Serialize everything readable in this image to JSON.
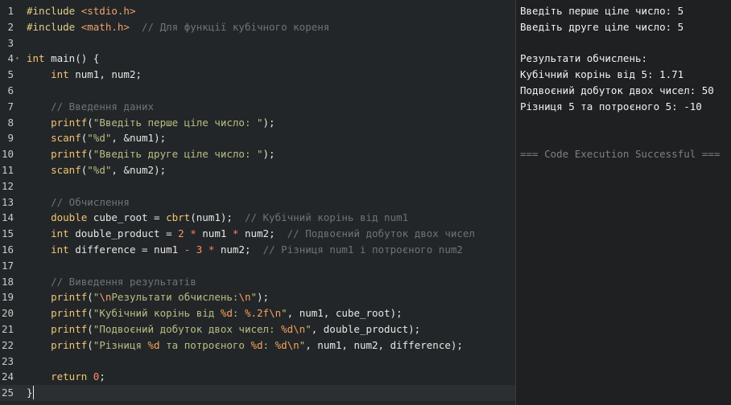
{
  "editor": {
    "lines": [
      {
        "n": "1",
        "tokens": [
          {
            "c": "pre",
            "t": "#include "
          },
          {
            "c": "inc",
            "t": "<stdio.h>"
          }
        ]
      },
      {
        "n": "2",
        "tokens": [
          {
            "c": "pre",
            "t": "#include "
          },
          {
            "c": "inc",
            "t": "<math.h>"
          },
          {
            "c": "",
            "t": "  "
          },
          {
            "c": "com",
            "t": "// Для функції кубічного кореня"
          }
        ]
      },
      {
        "n": "3",
        "tokens": []
      },
      {
        "n": "4",
        "fold": true,
        "tokens": [
          {
            "c": "kw",
            "t": "int"
          },
          {
            "c": "",
            "t": " main() {"
          }
        ]
      },
      {
        "n": "5",
        "tokens": [
          {
            "c": "",
            "t": "    "
          },
          {
            "c": "kw",
            "t": "int"
          },
          {
            "c": "",
            "t": " num1, num2;"
          }
        ]
      },
      {
        "n": "6",
        "tokens": []
      },
      {
        "n": "7",
        "tokens": [
          {
            "c": "",
            "t": "    "
          },
          {
            "c": "com",
            "t": "// Введення даних"
          }
        ]
      },
      {
        "n": "8",
        "tokens": [
          {
            "c": "",
            "t": "    "
          },
          {
            "c": "fn",
            "t": "printf"
          },
          {
            "c": "",
            "t": "("
          },
          {
            "c": "str",
            "t": "\"Введіть перше ціле число: \""
          },
          {
            "c": "",
            "t": ");"
          }
        ]
      },
      {
        "n": "9",
        "tokens": [
          {
            "c": "",
            "t": "    "
          },
          {
            "c": "fn",
            "t": "scanf"
          },
          {
            "c": "",
            "t": "("
          },
          {
            "c": "str",
            "t": "\"%d\""
          },
          {
            "c": "",
            "t": ", &num1);"
          }
        ]
      },
      {
        "n": "10",
        "tokens": [
          {
            "c": "",
            "t": "    "
          },
          {
            "c": "fn",
            "t": "printf"
          },
          {
            "c": "",
            "t": "("
          },
          {
            "c": "str",
            "t": "\"Введіть друге ціле число: \""
          },
          {
            "c": "",
            "t": ");"
          }
        ]
      },
      {
        "n": "11",
        "tokens": [
          {
            "c": "",
            "t": "    "
          },
          {
            "c": "fn",
            "t": "scanf"
          },
          {
            "c": "",
            "t": "("
          },
          {
            "c": "str",
            "t": "\"%d\""
          },
          {
            "c": "",
            "t": ", &num2);"
          }
        ]
      },
      {
        "n": "12",
        "tokens": []
      },
      {
        "n": "13",
        "tokens": [
          {
            "c": "",
            "t": "    "
          },
          {
            "c": "com",
            "t": "// Обчислення"
          }
        ]
      },
      {
        "n": "14",
        "tokens": [
          {
            "c": "",
            "t": "    "
          },
          {
            "c": "kw",
            "t": "double"
          },
          {
            "c": "",
            "t": " cube_root = "
          },
          {
            "c": "fn",
            "t": "cbrt"
          },
          {
            "c": "",
            "t": "(num1);  "
          },
          {
            "c": "com",
            "t": "// Кубічний корінь від num1"
          }
        ]
      },
      {
        "n": "15",
        "tokens": [
          {
            "c": "",
            "t": "    "
          },
          {
            "c": "kw",
            "t": "int"
          },
          {
            "c": "",
            "t": " double_product = "
          },
          {
            "c": "num",
            "t": "2"
          },
          {
            "c": "",
            "t": " "
          },
          {
            "c": "op",
            "t": "*"
          },
          {
            "c": "",
            "t": " num1 "
          },
          {
            "c": "op",
            "t": "*"
          },
          {
            "c": "",
            "t": " num2;  "
          },
          {
            "c": "com",
            "t": "// Подвоєний добуток двох чисел"
          }
        ]
      },
      {
        "n": "16",
        "tokens": [
          {
            "c": "",
            "t": "    "
          },
          {
            "c": "kw",
            "t": "int"
          },
          {
            "c": "",
            "t": " difference = num1 "
          },
          {
            "c": "op",
            "t": "-"
          },
          {
            "c": "",
            "t": " "
          },
          {
            "c": "num",
            "t": "3"
          },
          {
            "c": "",
            "t": " "
          },
          {
            "c": "op",
            "t": "*"
          },
          {
            "c": "",
            "t": " num2;  "
          },
          {
            "c": "com",
            "t": "// Різниця num1 і потроєного num2"
          }
        ]
      },
      {
        "n": "17",
        "tokens": []
      },
      {
        "n": "18",
        "tokens": [
          {
            "c": "",
            "t": "    "
          },
          {
            "c": "com",
            "t": "// Виведення результатів"
          }
        ]
      },
      {
        "n": "19",
        "tokens": [
          {
            "c": "",
            "t": "    "
          },
          {
            "c": "fn",
            "t": "printf"
          },
          {
            "c": "",
            "t": "("
          },
          {
            "c": "str",
            "t": "\""
          },
          {
            "c": "esc",
            "t": "\\n"
          },
          {
            "c": "str",
            "t": "Результати обчислень:"
          },
          {
            "c": "esc",
            "t": "\\n"
          },
          {
            "c": "str",
            "t": "\""
          },
          {
            "c": "",
            "t": ");"
          }
        ]
      },
      {
        "n": "20",
        "tokens": [
          {
            "c": "",
            "t": "    "
          },
          {
            "c": "fn",
            "t": "printf"
          },
          {
            "c": "",
            "t": "("
          },
          {
            "c": "str",
            "t": "\"Кубічний корінь від "
          },
          {
            "c": "esc",
            "t": "%d"
          },
          {
            "c": "str",
            "t": ": "
          },
          {
            "c": "esc",
            "t": "%.2f\\n"
          },
          {
            "c": "str",
            "t": "\""
          },
          {
            "c": "",
            "t": ", num1, cube_root);"
          }
        ]
      },
      {
        "n": "21",
        "tokens": [
          {
            "c": "",
            "t": "    "
          },
          {
            "c": "fn",
            "t": "printf"
          },
          {
            "c": "",
            "t": "("
          },
          {
            "c": "str",
            "t": "\"Подвоєний добуток двох чисел: "
          },
          {
            "c": "esc",
            "t": "%d\\n"
          },
          {
            "c": "str",
            "t": "\""
          },
          {
            "c": "",
            "t": ", double_product);"
          }
        ]
      },
      {
        "n": "22",
        "tokens": [
          {
            "c": "",
            "t": "    "
          },
          {
            "c": "fn",
            "t": "printf"
          },
          {
            "c": "",
            "t": "("
          },
          {
            "c": "str",
            "t": "\"Різниця "
          },
          {
            "c": "esc",
            "t": "%d"
          },
          {
            "c": "str",
            "t": " та потроєного "
          },
          {
            "c": "esc",
            "t": "%d"
          },
          {
            "c": "str",
            "t": ": "
          },
          {
            "c": "esc",
            "t": "%d\\n"
          },
          {
            "c": "str",
            "t": "\""
          },
          {
            "c": "",
            "t": ", num1, num2, difference);"
          }
        ]
      },
      {
        "n": "23",
        "tokens": []
      },
      {
        "n": "24",
        "tokens": [
          {
            "c": "",
            "t": "    "
          },
          {
            "c": "kw",
            "t": "return"
          },
          {
            "c": "",
            "t": " "
          },
          {
            "c": "num",
            "t": "0"
          },
          {
            "c": "",
            "t": ";"
          }
        ]
      },
      {
        "n": "25",
        "active": true,
        "tokens": [
          {
            "c": "",
            "t": "}"
          }
        ]
      }
    ]
  },
  "output": {
    "lines": [
      "Введіть перше ціле число: 5",
      "Введіть друге ціле число: 5",
      "",
      "Результати обчислень:",
      "Кубічний корінь від 5: 1.71",
      "Подвоєний добуток двох чисел: 50",
      "Різниця 5 та потроєного 5: -10",
      "",
      "",
      "=== Code Execution Successful ==="
    ]
  }
}
